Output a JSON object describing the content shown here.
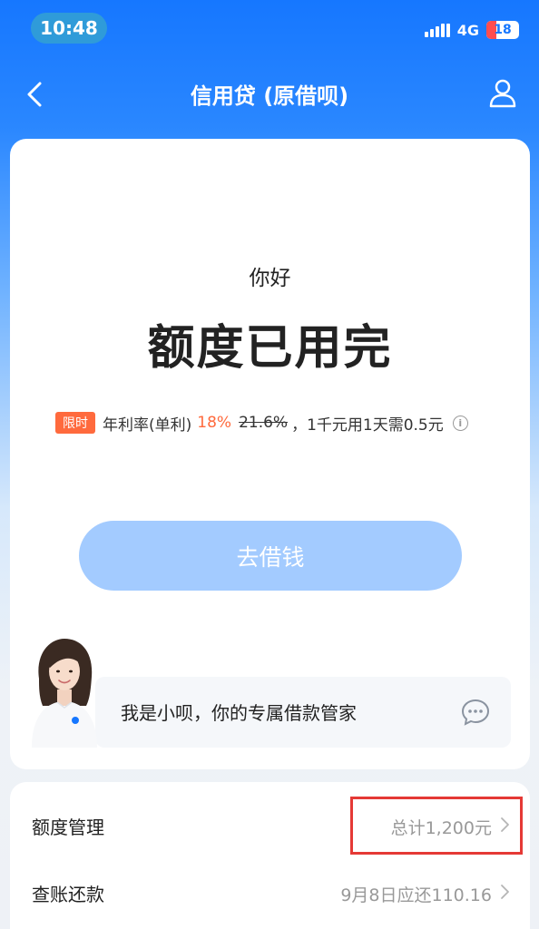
{
  "status_bar": {
    "time": "10:48",
    "network": "4G",
    "battery_level": "18"
  },
  "nav": {
    "title": "信用贷 (原借呗)"
  },
  "main": {
    "greeting": "你好",
    "quota_status": "额度已用完",
    "rate": {
      "badge": "限时",
      "label": "年利率(单利)",
      "current": "18%",
      "original": "21.6%",
      "description": "，1千元用1天需0.5元",
      "info_glyph": "i"
    },
    "borrow_button": "去借钱",
    "assistant": {
      "message": "我是小呗，你的专属借款管家"
    }
  },
  "list": [
    {
      "label": "额度管理",
      "value": "总计1,200元"
    },
    {
      "label": "查账还款",
      "value": "9月8日应还110.16"
    }
  ],
  "colors": {
    "primary": "#1677ff",
    "accent": "#ff6a3d",
    "button_disabled": "#a3cbff",
    "highlight": "#e53935"
  }
}
